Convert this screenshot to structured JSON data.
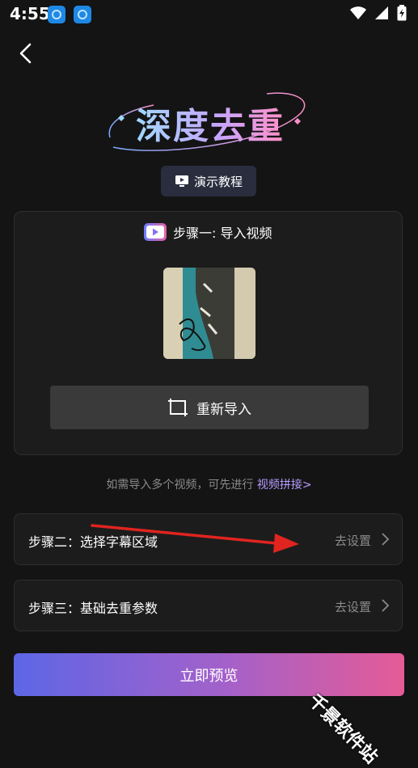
{
  "status_bar": {
    "time": "4:55"
  },
  "header": {
    "title": "深度去重",
    "tutorial_label": "演示教程"
  },
  "step1": {
    "title": "步骤一: 导入视频",
    "reimport_label": "重新导入"
  },
  "hint": {
    "text": "如需导入多个视频，可先进行",
    "link": "视频拼接>"
  },
  "step2": {
    "label": "步骤二：选择字幕区域",
    "action": "去设置"
  },
  "step3": {
    "label": "步骤三：基础去重参数",
    "action": "去设置"
  },
  "preview_button": "立即预览",
  "watermark": "千景软件站",
  "colors": {
    "accent_start": "#5d66e6",
    "accent_end": "#e55b97",
    "annotation_arrow": "#e0241f",
    "link": "#b79cff"
  },
  "icons": [
    "back-arrow-icon",
    "play-screen-icon",
    "video-play-icon",
    "reimport-icon",
    "chevron-right-icon",
    "wifi-icon",
    "signal-icon",
    "battery-icon"
  ]
}
